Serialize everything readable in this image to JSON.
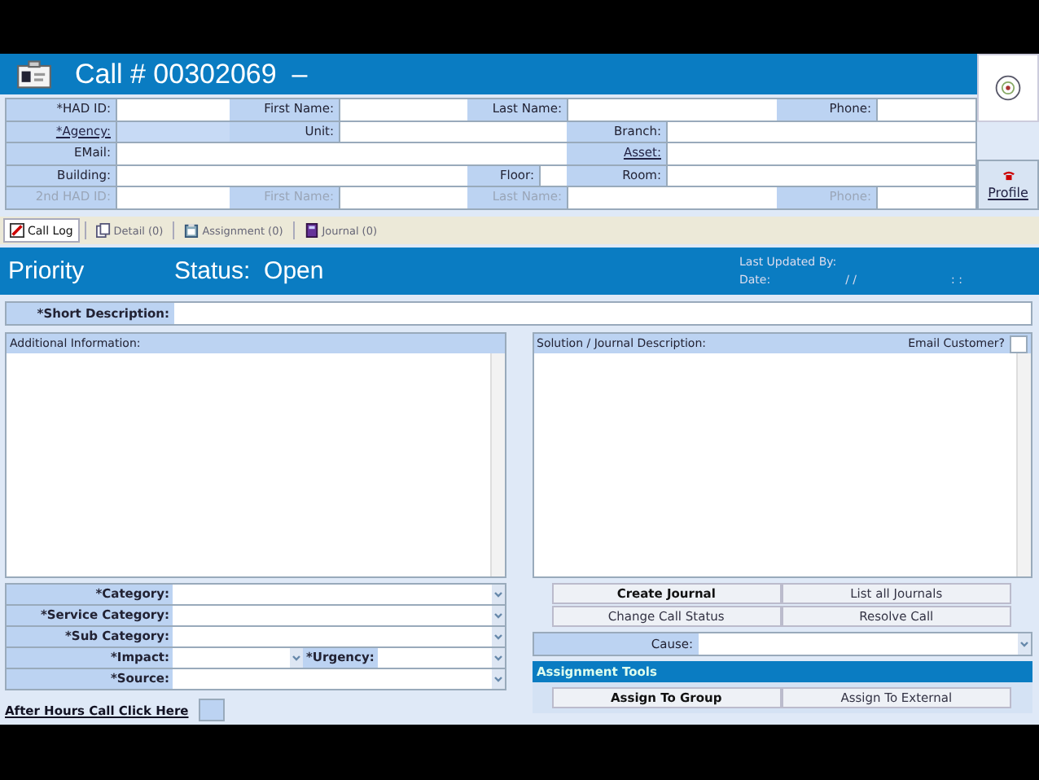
{
  "window": {
    "title": "Call # 00302069  –"
  },
  "form": {
    "fields": [
      {
        "label": "*HAD ID:",
        "link": false,
        "readonly": false,
        "disabled": false
      },
      {
        "label": "First Name:",
        "link": false,
        "readonly": false,
        "disabled": false
      },
      {
        "label": "Last Name:",
        "link": false,
        "readonly": false,
        "disabled": false
      },
      {
        "label": "Phone:",
        "link": false,
        "readonly": false,
        "disabled": false
      },
      {
        "label": "*Agency:",
        "link": true,
        "readonly": true,
        "disabled": false
      },
      {
        "label": "Unit:",
        "link": false,
        "readonly": false,
        "disabled": false
      },
      {
        "label": "Branch:",
        "link": false,
        "readonly": false,
        "disabled": false
      },
      {
        "label": "EMail:",
        "link": false,
        "readonly": false,
        "disabled": false
      },
      {
        "label": "Asset:",
        "link": true,
        "readonly": false,
        "disabled": false
      },
      {
        "label": "Building:",
        "link": false,
        "readonly": false,
        "disabled": false
      },
      {
        "label": "Floor:",
        "link": false,
        "readonly": false,
        "disabled": false
      },
      {
        "label": "Room:",
        "link": false,
        "readonly": false,
        "disabled": false
      },
      {
        "label": "2nd HAD ID:",
        "link": false,
        "readonly": false,
        "disabled": true
      },
      {
        "label": "First Name:",
        "link": false,
        "readonly": false,
        "disabled": true
      },
      {
        "label": "Last Name:",
        "link": false,
        "readonly": false,
        "disabled": true
      },
      {
        "label": "Phone:",
        "link": false,
        "readonly": false,
        "disabled": true
      }
    ]
  },
  "profile_button": {
    "label": "Profile"
  },
  "tabs": [
    {
      "label": "Call Log",
      "selected": true
    },
    {
      "label": "Detail (0)",
      "selected": false
    },
    {
      "label": "Assignment (0)",
      "selected": false
    },
    {
      "label": "Journal (0)",
      "selected": false
    }
  ],
  "banner": {
    "priority": "Priority",
    "status": "Status:  Open",
    "last_updated_label": "Last Updated By:",
    "date_label": "Date:",
    "date_value": "/ /",
    "time_value": ": :"
  },
  "short_description": {
    "label": "*Short Description:"
  },
  "additional_info": {
    "label": "Additional Information:"
  },
  "solution": {
    "label": "Solution / Journal Description:",
    "email_label": "Email Customer?",
    "email_checked": false
  },
  "classification": [
    [
      {
        "label": "*Category:"
      }
    ],
    [
      {
        "label": "*Service Category:"
      }
    ],
    [
      {
        "label": "*Sub Category:"
      }
    ],
    [
      {
        "label": "*Impact:"
      },
      {
        "label": "*Urgency:"
      }
    ],
    [
      {
        "label": "*Source:"
      }
    ]
  ],
  "after_hours": {
    "label": "After Hours Call Click Here",
    "checked": false
  },
  "journal_buttons": [
    {
      "label": "Create Journal",
      "emphasized": true
    },
    {
      "label": "List all Journals",
      "emphasized": false
    },
    {
      "label": "Change Call Status",
      "emphasized": false
    },
    {
      "label": "Resolve Call",
      "emphasized": false
    }
  ],
  "cause": {
    "label": "Cause:"
  },
  "assignment_tools": {
    "title": "Assignment Tools",
    "buttons": [
      {
        "label": "Assign To Group",
        "emphasized": true
      },
      {
        "label": "Assign To External",
        "emphasized": false
      }
    ]
  }
}
